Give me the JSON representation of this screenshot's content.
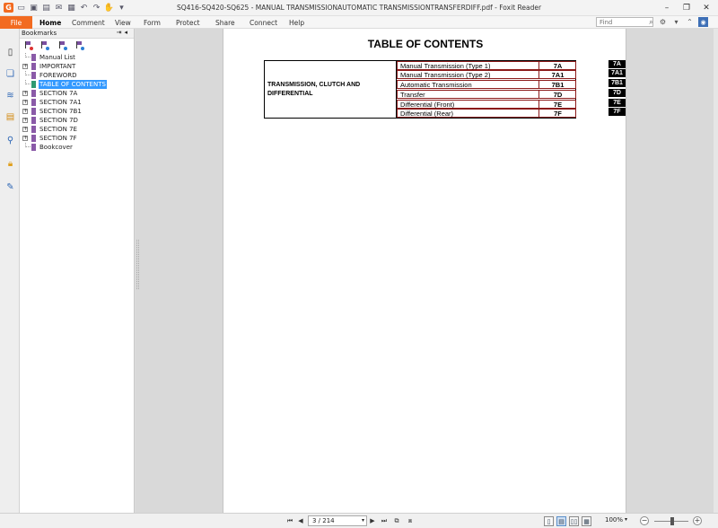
{
  "window": {
    "title": "SQ416-SQ420-SQ625 - MANUAL TRANSMISSIONAUTOMATIC TRANSMISSIONTRANSFERDIFF.pdf - Foxit Reader"
  },
  "quick_access": {
    "app_icon": "G",
    "icons": [
      "open-icon",
      "save-icon",
      "print-icon",
      "email-icon",
      "scan-icon",
      "undo-icon",
      "redo-icon",
      "hand-tool-icon"
    ]
  },
  "menu": {
    "file": "File",
    "items": [
      "Home",
      "Comment",
      "View",
      "Form",
      "Protect",
      "Share",
      "Connect",
      "Help"
    ],
    "active": "Home",
    "search_placeholder": "Find"
  },
  "bookmarks": {
    "header": "Bookmarks",
    "items": [
      {
        "label": "Manual List",
        "expandable": false,
        "selected": false
      },
      {
        "label": "IMPORTANT",
        "expandable": true,
        "selected": false
      },
      {
        "label": "FOREWORD",
        "expandable": false,
        "selected": false
      },
      {
        "label": "TABLE OF CONTENTS",
        "expandable": false,
        "selected": true
      },
      {
        "label": "SECTION 7A",
        "expandable": true,
        "selected": false
      },
      {
        "label": "SECTION 7A1",
        "expandable": true,
        "selected": false
      },
      {
        "label": "SECTION 7B1",
        "expandable": true,
        "selected": false
      },
      {
        "label": "SECTION 7D",
        "expandable": true,
        "selected": false
      },
      {
        "label": "SECTION 7E",
        "expandable": true,
        "selected": false
      },
      {
        "label": "SECTION 7F",
        "expandable": true,
        "selected": false
      },
      {
        "label": "Bookcover",
        "expandable": false,
        "selected": false
      }
    ]
  },
  "document": {
    "heading": "TABLE OF CONTENTS",
    "group_label": "TRANSMISSION, CLUTCH AND DIFFERENTIAL",
    "rows": [
      {
        "name": "Manual Transmission (Type 1)",
        "code": "7A"
      },
      {
        "name": "Manual Transmission (Type 2)",
        "code": "7A1"
      },
      {
        "name": "Automatic Transmission",
        "code": "7B1"
      },
      {
        "name": "Transfer",
        "code": "7D"
      },
      {
        "name": "Differential (Front)",
        "code": "7E"
      },
      {
        "name": "Differential (Rear)",
        "code": "7F"
      }
    ],
    "tabs": [
      "7A",
      "7A1",
      "7B1",
      "7D",
      "7E",
      "7F"
    ]
  },
  "status": {
    "page_indicator": "3 / 214",
    "zoom": "100%"
  },
  "colors": {
    "accent": "#f26b21",
    "selection": "#3399ff",
    "toc_border": "#8b1a1a"
  }
}
